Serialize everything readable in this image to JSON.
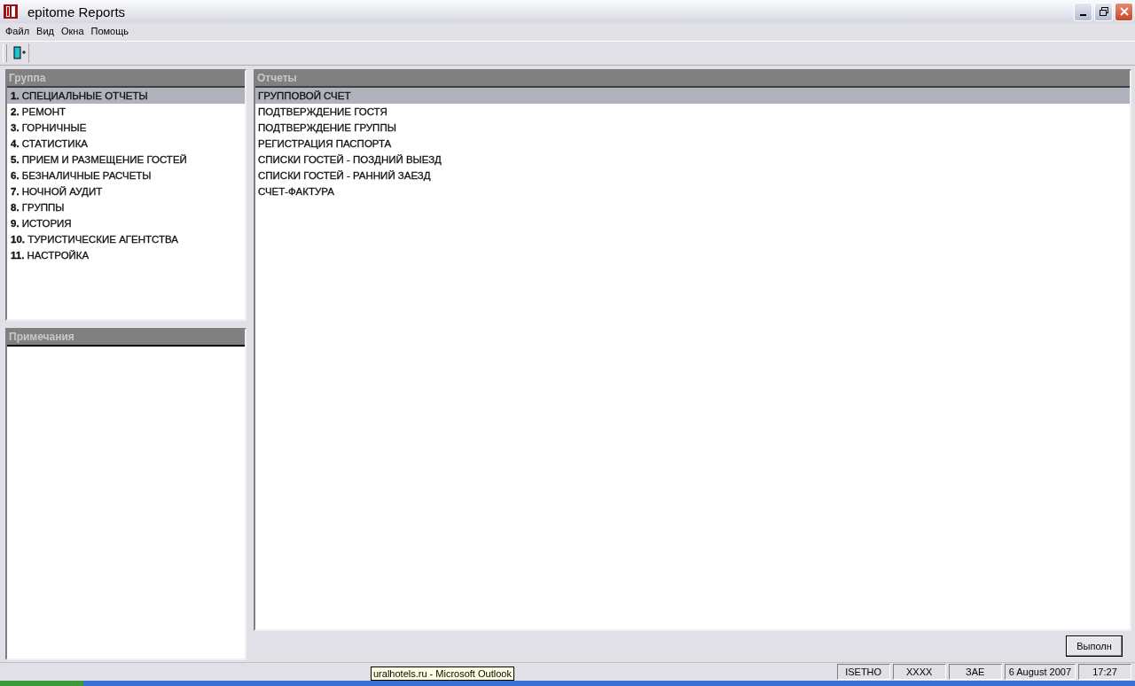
{
  "window": {
    "title": "epitome Reports"
  },
  "menu": [
    "Файл",
    "Вид",
    "Окна",
    "Помощь"
  ],
  "groups": {
    "title": "Группа",
    "items": [
      {
        "number": "1.",
        "label": "СПЕЦИАЛЬНЫЕ ОТЧЕТЫ",
        "selected": true
      },
      {
        "number": "2.",
        "label": "РЕМОНТ",
        "selected": false
      },
      {
        "number": "3.",
        "label": "ГОРНИЧНЫЕ",
        "selected": false
      },
      {
        "number": "4.",
        "label": "СТАТИСТИКА",
        "selected": false
      },
      {
        "number": "5.",
        "label": "ПРИЕМ И РАЗМЕЩЕНИЕ ГОСТЕЙ",
        "selected": false
      },
      {
        "number": "6.",
        "label": "БЕЗНАЛИЧНЫЕ РАСЧЕТЫ",
        "selected": false
      },
      {
        "number": "7.",
        "label": "НОЧНОЙ АУДИТ",
        "selected": false
      },
      {
        "number": "8.",
        "label": "ГРУППЫ",
        "selected": false
      },
      {
        "number": "9.",
        "label": "ИСТОРИЯ",
        "selected": false
      },
      {
        "number": "10.",
        "label": "ТУРИСТИЧЕСКИЕ АГЕНТСТВА",
        "selected": false
      },
      {
        "number": "11.",
        "label": "НАСТРОЙКА",
        "selected": false
      }
    ]
  },
  "notes": {
    "title": "Примечания"
  },
  "reports": {
    "title": "Отчеты",
    "items": [
      {
        "label": "ГРУППОВОЙ СЧЕТ",
        "selected": true
      },
      {
        "label": "ПОДТВЕРЖДЕНИЕ ГОСТЯ",
        "selected": false
      },
      {
        "label": "ПОДТВЕРЖДЕНИЕ ГРУППЫ",
        "selected": false
      },
      {
        "label": "РЕГИСТРАЦИЯ ПАСПОРТА",
        "selected": false
      },
      {
        "label": "СПИСКИ ГОСТЕЙ - ПОЗДНИЙ ВЫЕЗД",
        "selected": false
      },
      {
        "label": "СПИСКИ ГОСТЕЙ - РАННИЙ ЗАЕЗД",
        "selected": false
      },
      {
        "label": "СЧЕТ-ФАКТУРА",
        "selected": false
      }
    ]
  },
  "run_button": "Выполн",
  "status_bar": [
    "ISETHO",
    "XXXX",
    "ЗАЕ",
    "6 August 2007",
    "17:27"
  ],
  "tooltip": "uralhotels.ru - Microsoft Outlook"
}
